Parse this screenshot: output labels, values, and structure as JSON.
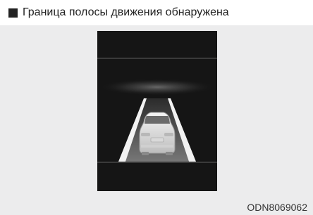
{
  "header": {
    "title": "Граница полосы движения обнаружена"
  },
  "figure": {
    "code": "ODN8069062",
    "colors": {
      "screen_bg": "#151515",
      "lane_line": "#f2f2f2",
      "road": "#5a5a5a",
      "car": "#e8e8e8"
    }
  }
}
